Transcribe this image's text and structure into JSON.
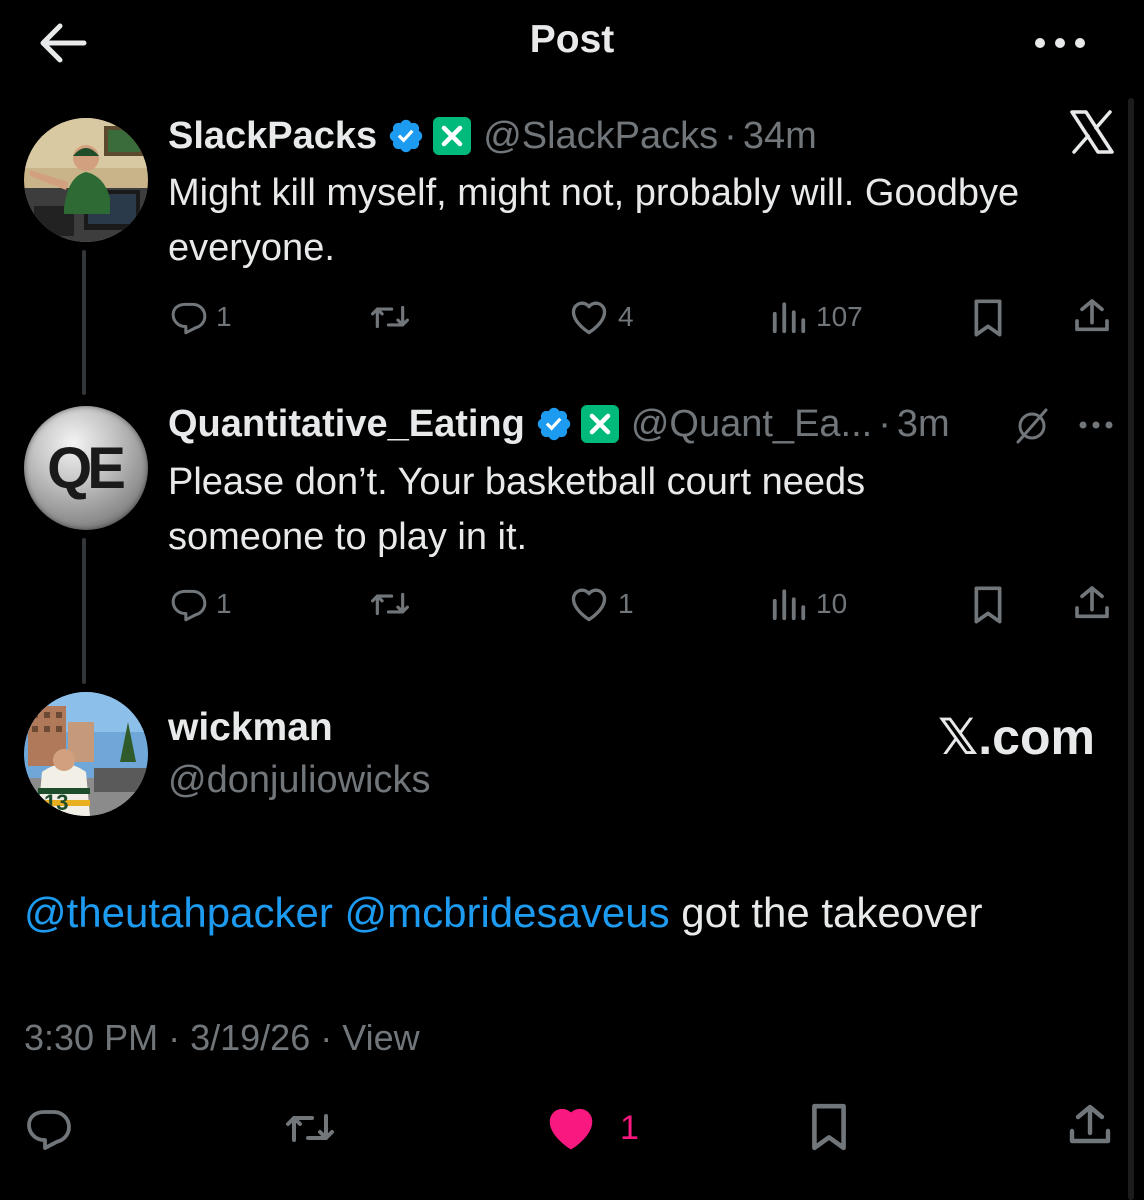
{
  "header": {
    "title": "Post"
  },
  "posts": [
    {
      "name": "SlackPacks",
      "handle": "@SlackPacks",
      "separator": "·",
      "time": "34m",
      "text_line1": "Might kill myself, might not, probably will. Goodbye",
      "text_line2": "everyone.",
      "replies": "1",
      "likes": "4",
      "views": "107",
      "source_icon": "x-logo-icon"
    },
    {
      "name": "Quantitative_Eating",
      "avatar_text": "QE",
      "handle": "@Quant_Ea...",
      "separator": "·",
      "time": "3m",
      "text_line1": "Please don’t. Your basketball court needs",
      "text_line2": "someone to play in it.",
      "replies": "1",
      "likes": "1",
      "views": "10"
    }
  ],
  "main_post": {
    "name": "wickman",
    "handle": "@donjuliowicks",
    "brand": "𝕏.com",
    "mention1": "@theutahpacker",
    "mention2": "@mcbridesaveus",
    "text": "got the takeover",
    "time": "3:30 PM",
    "separator": "·",
    "date": "3/19/26",
    "view_label": "View",
    "likes": "1"
  },
  "colors": {
    "background": "#000000",
    "text": "#e7e9ea",
    "muted": "#71767b",
    "link": "#1d9bf0",
    "like": "#f91880",
    "verified": "#1d9bf0",
    "x_badge": "#00ba7c"
  }
}
